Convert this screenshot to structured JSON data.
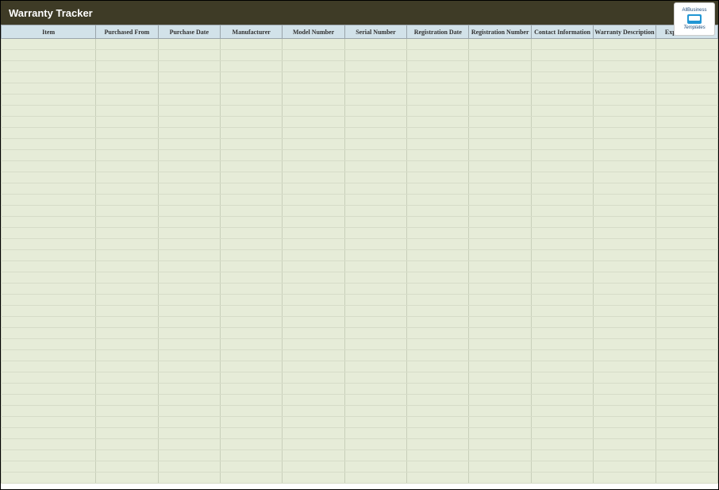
{
  "header": {
    "title": "Warranty Tracker",
    "logo_line1": "AllBusiness",
    "logo_line2": "Templates"
  },
  "columns": [
    "Item",
    "Purchased From",
    "Purchase Date",
    "Manufacturer",
    "Model Number",
    "Serial Number",
    "Registration Date",
    "Registration Number",
    "Contact Information",
    "Warranty Description",
    "Expiration Date"
  ],
  "row_count": 40
}
